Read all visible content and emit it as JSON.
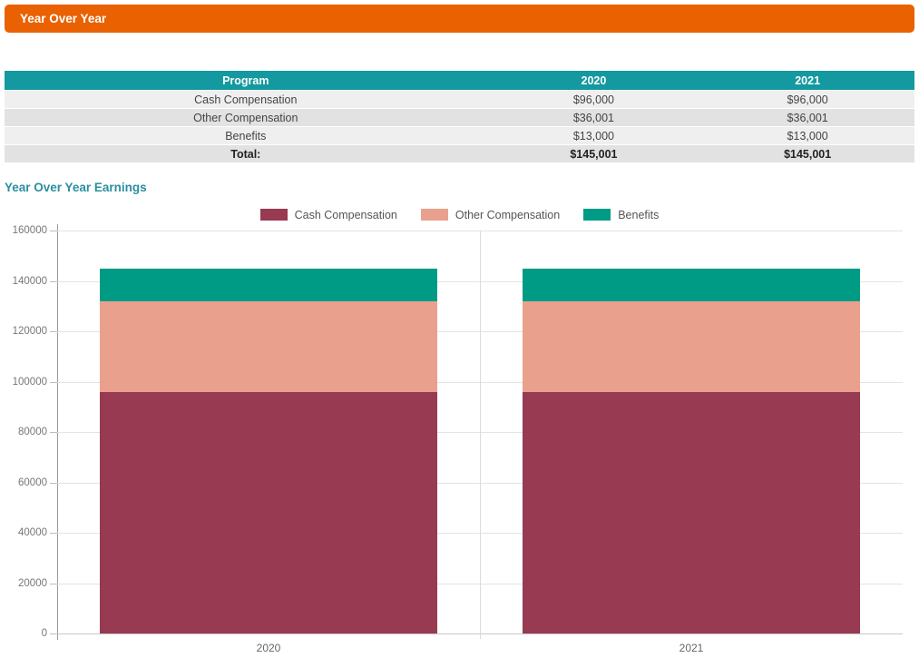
{
  "header": {
    "title": "Year Over Year"
  },
  "table": {
    "columns": [
      "Program",
      "2020",
      "2021"
    ],
    "rows": [
      {
        "label": "Cash Compensation",
        "values": [
          "$96,000",
          "$96,000"
        ]
      },
      {
        "label": "Other Compensation",
        "values": [
          "$36,001",
          "$36,001"
        ]
      },
      {
        "label": "Benefits",
        "values": [
          "$13,000",
          "$13,000"
        ]
      }
    ],
    "total_row": {
      "label": "Total:",
      "values": [
        "$145,001",
        "$145,001"
      ]
    }
  },
  "section": {
    "title": "Year Over Year Earnings"
  },
  "chart_data": {
    "type": "bar",
    "stacked": true,
    "title": "Year Over Year Earnings",
    "categories": [
      "2020",
      "2021"
    ],
    "series": [
      {
        "name": "Cash Compensation",
        "color": "#973A52",
        "values": [
          96000,
          96000
        ]
      },
      {
        "name": "Other Compensation",
        "color": "#E9A18E",
        "values": [
          36001,
          36001
        ]
      },
      {
        "name": "Benefits",
        "color": "#009B84",
        "values": [
          13000,
          13000
        ]
      }
    ],
    "totals": [
      145001,
      145001
    ],
    "ylim": [
      0,
      160000
    ],
    "ytick_step": 20000,
    "grid": true,
    "legend_position": "top"
  },
  "colors": {
    "header_bar": "#E96100",
    "table_header": "#13999F",
    "row_light": "#EFEFEF",
    "row_dark": "#E2E2E2",
    "section_title": "#2C8FA0"
  }
}
